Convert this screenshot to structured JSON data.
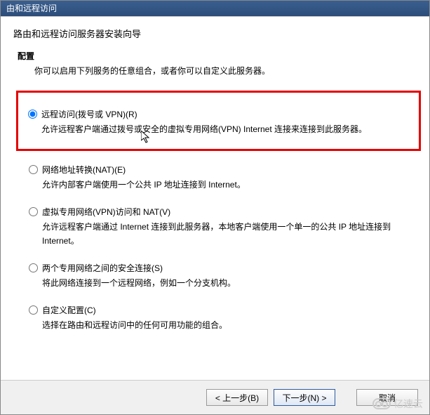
{
  "titlebar": "由和远程访问",
  "wizard": {
    "title": "路由和远程访问服务器安装向导",
    "section_title": "配置",
    "section_desc": "你可以启用下列服务的任意组合，或者你可以自定义此服务器。"
  },
  "options": [
    {
      "label": "远程访问(拨号或 VPN)(R)",
      "desc": "允许远程客户端通过拨号或安全的虚拟专用网络(VPN) Internet 连接来连接到此服务器。",
      "selected": true
    },
    {
      "label": "网络地址转换(NAT)(E)",
      "desc": "允许内部客户端使用一个公共 IP 地址连接到 Internet。",
      "selected": false
    },
    {
      "label": "虚拟专用网络(VPN)访问和 NAT(V)",
      "desc": "允许远程客户端通过 Internet 连接到此服务器，本地客户端使用一个单一的公共 IP 地址连接到 Internet。",
      "selected": false
    },
    {
      "label": "两个专用网络之间的安全连接(S)",
      "desc": "将此网络连接到一个远程网络，例如一个分支机构。",
      "selected": false
    },
    {
      "label": "自定义配置(C)",
      "desc": "选择在路由和远程访问中的任何可用功能的组合。",
      "selected": false
    }
  ],
  "buttons": {
    "back": "< 上一步(B)",
    "next": "下一步(N) >",
    "cancel": "取消"
  },
  "watermark": "亿速云"
}
